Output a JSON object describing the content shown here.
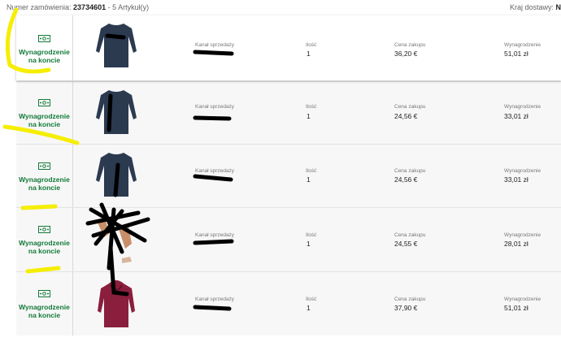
{
  "header": {
    "order_label": "Numer zamówienia:",
    "order_number": "23734601",
    "items_count": "- 5 Artykuł(y)",
    "country_label": "Kraj dostawy:",
    "country_value": "N"
  },
  "columns": {
    "channel": "Kanał sprzedaży",
    "quantity": "Ilość",
    "price": "Cena zakupu",
    "reward": "Wynagrodzenie"
  },
  "reward_line1": "Wynagrodzenie",
  "reward_line2": "na koncie",
  "icon_name": "money-bill-icon",
  "colors": {
    "reward_green": "#137a39",
    "highlight": "#f5ee00",
    "scribble": "#000000"
  },
  "items": [
    {
      "product": "navy long-sleeve top",
      "quantity": "1",
      "price": "36,20 €",
      "reward": "51,01 zł"
    },
    {
      "product": "navy long-sleeve top",
      "quantity": "1",
      "price": "24,56 €",
      "reward": "33,01 zł"
    },
    {
      "product": "navy long-sleeve top",
      "quantity": "1",
      "price": "24,56 €",
      "reward": "33,01 zł"
    },
    {
      "product": "sandals",
      "quantity": "1",
      "price": "24,55 €",
      "reward": "28,01 zł"
    },
    {
      "product": "burgundy hoodie",
      "quantity": "1",
      "price": "37,90 €",
      "reward": "51,01 zł"
    }
  ]
}
